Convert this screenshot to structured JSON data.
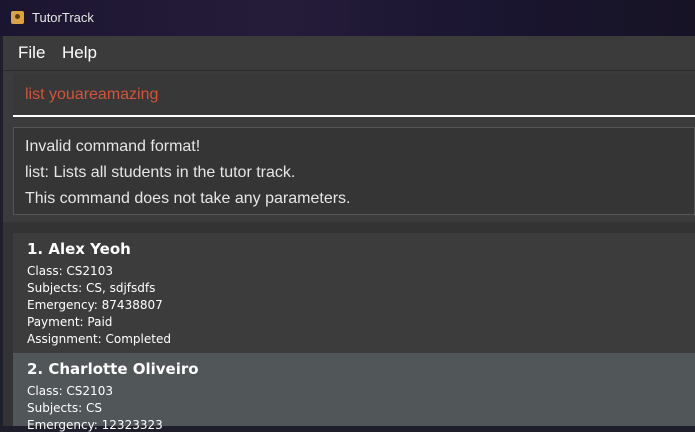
{
  "window": {
    "title": "TutorTrack",
    "icon": "app-icon"
  },
  "menu": {
    "items": [
      "File",
      "Help"
    ]
  },
  "command": {
    "value": "list youareamazing"
  },
  "result": {
    "lines": [
      "Invalid command format!",
      "list: Lists all students in the tutor track.",
      "This command does not take any parameters."
    ]
  },
  "persons": [
    {
      "name": "1.  Alex Yeoh",
      "class": "Class: CS2103",
      "subjects": "Subjects: CS, sdjfsdfs",
      "emergency": "Emergency: 87438807",
      "payment": "Payment: Paid",
      "assignment": "Assignment: Completed"
    },
    {
      "name": "2.  Charlotte Oliveiro",
      "class": "Class: CS2103",
      "subjects": "Subjects: CS",
      "emergency": "Emergency: 12323323"
    }
  ],
  "colors": {
    "command_error_text": "#d0553a",
    "card_odd": "#3c3c3c",
    "card_even": "#515658"
  }
}
